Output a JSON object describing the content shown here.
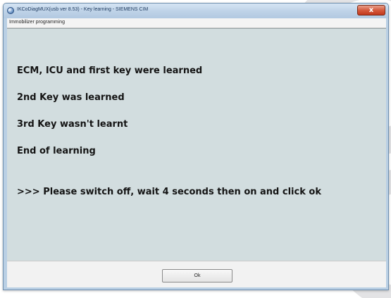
{
  "window": {
    "title": "IKCoDiagMUX(usb ver 8.53) - Key learning - SIEMENS CIM",
    "close_label": "x"
  },
  "menubar": {
    "label": "Immobilizer programming"
  },
  "messages": [
    "ECM, ICU and first key were learned",
    "2nd Key was learned",
    "3rd Key wasn't learnt",
    "End of learning",
    ">>> Please switch off, wait 4 seconds then on and click ok"
  ],
  "footer": {
    "ok_label": "Ok"
  },
  "colors": {
    "content_bg": "#d2dddf",
    "frame": "#b9cfe4",
    "close_button": "#c2381c"
  },
  "icons": {
    "app": "app-icon",
    "close": "close-icon"
  }
}
